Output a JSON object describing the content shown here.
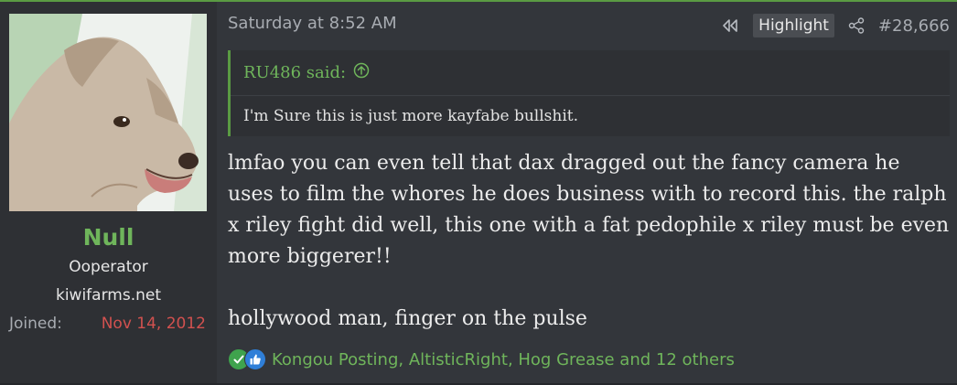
{
  "user": {
    "name": "Null",
    "title": "Ooperator",
    "banner": "kiwifarms.net",
    "joined_label": "Joined:",
    "joined_value": "Nov 14, 2012",
    "avatar_icon": "dog-avatar-icon"
  },
  "post": {
    "date": "Saturday at 8:52 AM",
    "highlight_label": "Highlight",
    "post_number": "#28,666",
    "icons": {
      "rewind": "rewind-icon",
      "share": "share-icon",
      "quote_jump": "arrow-up-circle-icon"
    }
  },
  "quote": {
    "attribution": "RU486 said:",
    "text": "I'm Sure this is just more kayfabe bullshit."
  },
  "message": {
    "paragraph1": "lmfao you can even tell that dax dragged out the fancy camera he uses to film the whores he does business with to record this. the ralph x riley fight did well, this one with a fat pedophile x riley must be even more biggerer!!",
    "paragraph2": "hollywood man, finger on the pulse"
  },
  "reactions": {
    "text": "Kongou Posting, AltisticRight, Hog Grease and 12 others",
    "icons": [
      "check-reaction-icon",
      "like-reaction-icon"
    ]
  },
  "colors": {
    "accent_green": "#6fb55b",
    "joined_red": "#d2514f",
    "post_bg": "#33363b",
    "sidebar_bg": "#2e3034"
  }
}
